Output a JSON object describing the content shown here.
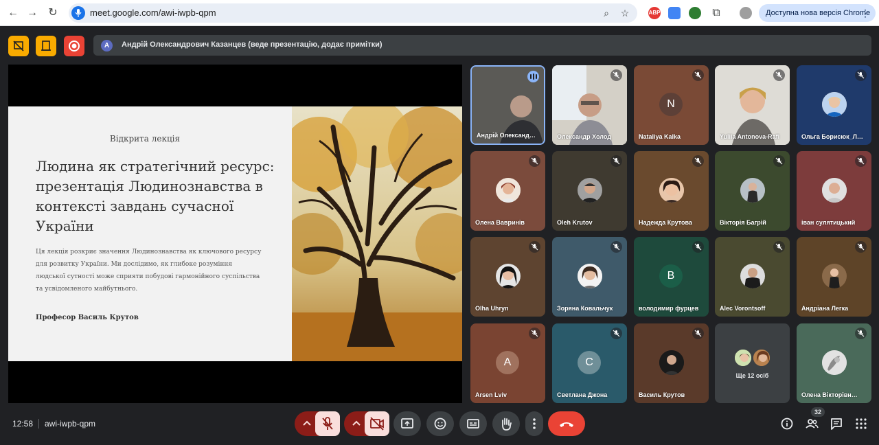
{
  "browser": {
    "url": "meet.google.com/awi-iwpb-qpm",
    "update_label": "Доступна нова версія Chrome",
    "ext_abp": "ABP"
  },
  "presenter": {
    "avatar_letter": "A",
    "text": "Андрій Олександрович Казанцев (веде презентацію, додає примітки)"
  },
  "slide": {
    "kicker": "Відкрита лекція",
    "title": "Людина як стратегічний ресурс: презентація Людинознавства в контексті завдань сучасної України",
    "body": "Ця лекція розкриє значення Людинознавства як ключового ресурсу для розвитку України. Ми дослідимо, як глибоке розуміння людської сутності може сприяти побудові гармонійного суспільства та усвідомленого майбутнього.",
    "author": "Професор Василь Крутов"
  },
  "participants": [
    {
      "name": "Андрій Олександ…",
      "state": "speaking"
    },
    {
      "name": "Олександр Холод",
      "state": "muted"
    },
    {
      "name": "Nataliya Kalka",
      "state": "muted",
      "letter": "N"
    },
    {
      "name": "Yuliia Antonova-Rafi",
      "state": "muted"
    },
    {
      "name": "Ольга Борисюк_Л…",
      "state": "muted"
    },
    {
      "name": "Олена Вавринів",
      "state": "muted"
    },
    {
      "name": "Oleh Krutov",
      "state": "muted"
    },
    {
      "name": "Надежда Крутова",
      "state": "muted"
    },
    {
      "name": "Вікторія Багрій",
      "state": "muted"
    },
    {
      "name": "іван сулятицький",
      "state": "muted"
    },
    {
      "name": "Olha Uhryn",
      "state": "muted"
    },
    {
      "name": "Зоряна Ковальчук",
      "state": "muted"
    },
    {
      "name": "володимир фурцев",
      "state": "muted",
      "letter": "B"
    },
    {
      "name": "Alec Vorontsoff",
      "state": "muted"
    },
    {
      "name": "Андріана Легка",
      "state": "muted"
    },
    {
      "name": "Arsen Lviv",
      "state": "muted",
      "letter": "A"
    },
    {
      "name": "Светлана Джона",
      "state": "muted",
      "letter": "C"
    },
    {
      "name": "Василь Крутов",
      "state": "muted"
    },
    {
      "name": "Ще 12 осіб",
      "state": "more"
    },
    {
      "name": "Олена Вікторівн…",
      "state": "muted"
    }
  ],
  "meeting": {
    "time": "12:58",
    "code": "awi-iwpb-qpm",
    "people_count": "32"
  },
  "colors": {
    "accent_blue": "#8ab4f8",
    "hangup_red": "#ea4335",
    "mic_off_bg": "#f9dedc",
    "top_yellow": "#f9ab00",
    "record_red": "#ea4335"
  }
}
